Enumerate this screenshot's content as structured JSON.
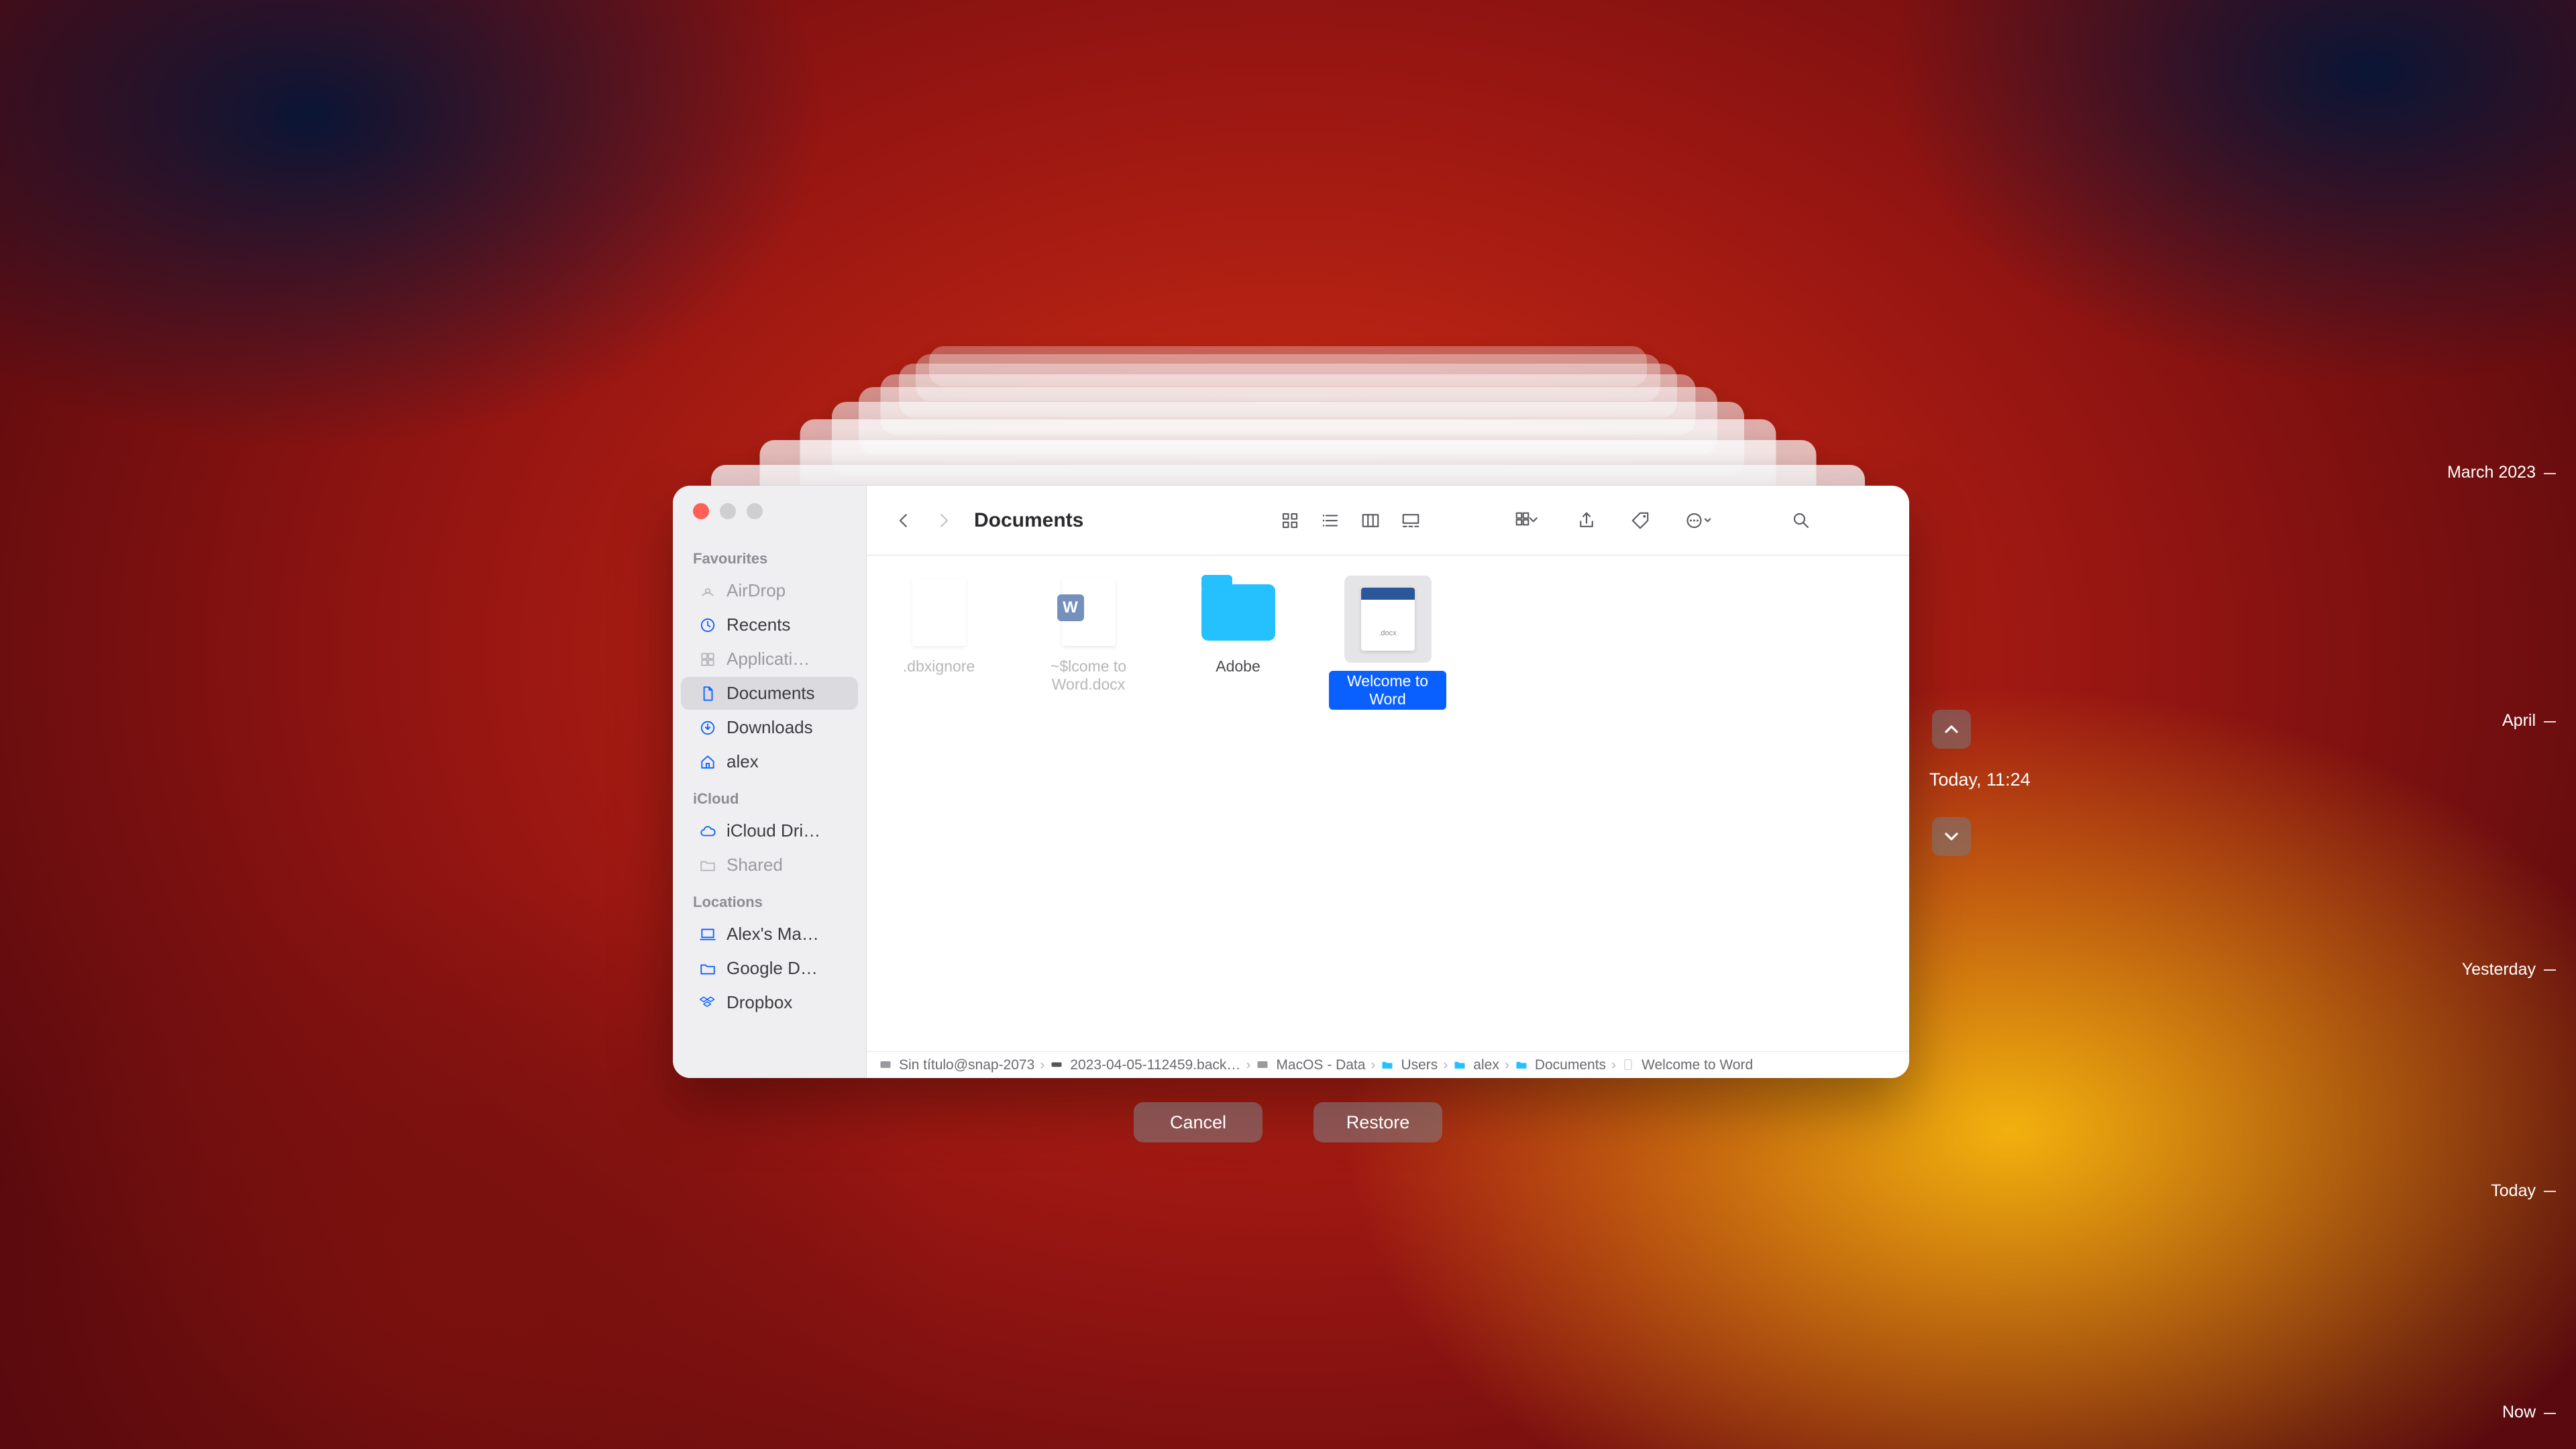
{
  "window_title": "Documents",
  "sidebar": {
    "groups": [
      {
        "label": "Favourites",
        "items": [
          {
            "name": "AirDrop",
            "icon": "airdrop",
            "dim": true
          },
          {
            "name": "Recents",
            "icon": "clock"
          },
          {
            "name": "Applicati…",
            "icon": "apps",
            "dim": true
          },
          {
            "name": "Documents",
            "icon": "doc",
            "active": true
          },
          {
            "name": "Downloads",
            "icon": "download"
          },
          {
            "name": "alex",
            "icon": "home"
          }
        ]
      },
      {
        "label": "iCloud",
        "items": [
          {
            "name": "iCloud Dri…",
            "icon": "cloud"
          },
          {
            "name": "Shared",
            "icon": "folder",
            "dim": true
          }
        ]
      },
      {
        "label": "Locations",
        "items": [
          {
            "name": "Alex's Ma…",
            "icon": "laptop"
          },
          {
            "name": "Google D…",
            "icon": "folder"
          },
          {
            "name": "Dropbox",
            "icon": "dropbox"
          }
        ]
      }
    ]
  },
  "toolbar": {
    "view_icons": [
      "grid",
      "list",
      "columns",
      "gallery"
    ],
    "right_icons": [
      "group",
      "share",
      "tag",
      "more",
      "search"
    ]
  },
  "files": [
    {
      "name": ".dbxignore",
      "kind": "file-dim"
    },
    {
      "name": "~$lcome to Word.docx",
      "kind": "word-dim"
    },
    {
      "name": "Adobe",
      "kind": "folder"
    },
    {
      "name": "Welcome to Word",
      "kind": "word-sel"
    }
  ],
  "pathbar": [
    {
      "icon": "drive",
      "text": "Sin título@snap-2073"
    },
    {
      "icon": "disk",
      "text": "2023-04-05-112459.back…"
    },
    {
      "icon": "drive",
      "text": "MacOS - Data"
    },
    {
      "icon": "folder",
      "text": "Users"
    },
    {
      "icon": "folder",
      "text": "alex"
    },
    {
      "icon": "folder",
      "text": "Documents"
    },
    {
      "icon": "doc",
      "text": "Welcome to Word"
    }
  ],
  "time_machine": {
    "current_label": "Today, 11:24",
    "timeline": [
      "March 2023",
      "April",
      "Yesterday",
      "Today",
      "Now"
    ]
  },
  "actions": {
    "cancel": "Cancel",
    "restore": "Restore"
  }
}
